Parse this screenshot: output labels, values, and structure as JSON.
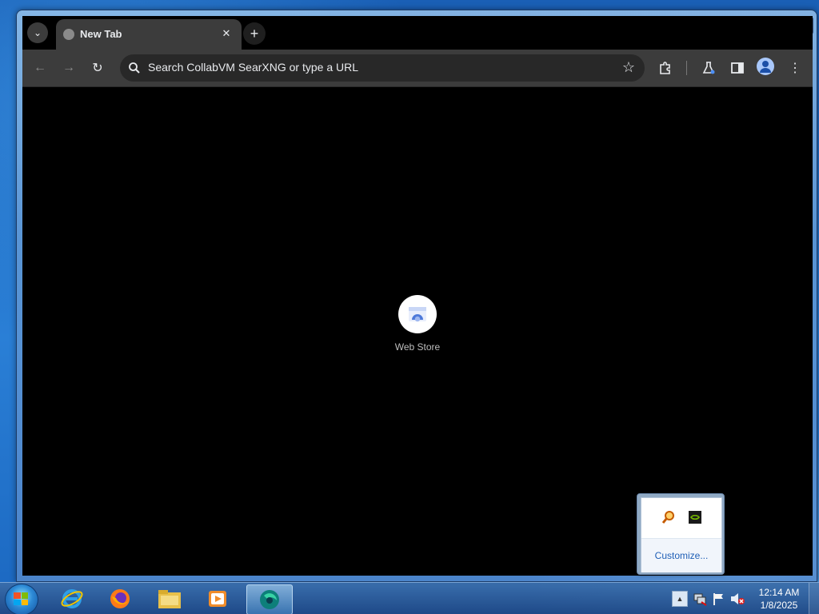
{
  "browser": {
    "tab": {
      "title": "New Tab"
    },
    "omnibox": {
      "placeholder": "Search CollabVM SearXNG or type a URL"
    },
    "shortcuts": [
      {
        "label": "Web Store",
        "icon": "web-store-icon"
      }
    ],
    "theme": {
      "background": "#000000",
      "toolbar": "#3c3c3c",
      "text": "#e8eaed"
    }
  },
  "tray_popup": {
    "customize_label": "Customize..."
  },
  "taskbar": {
    "apps": [
      "internet-explorer-icon",
      "firefox-icon",
      "file-explorer-icon",
      "media-player-icon",
      "browser-icon"
    ],
    "clock": {
      "time": "12:14 AM",
      "date": "1/8/2025"
    }
  }
}
